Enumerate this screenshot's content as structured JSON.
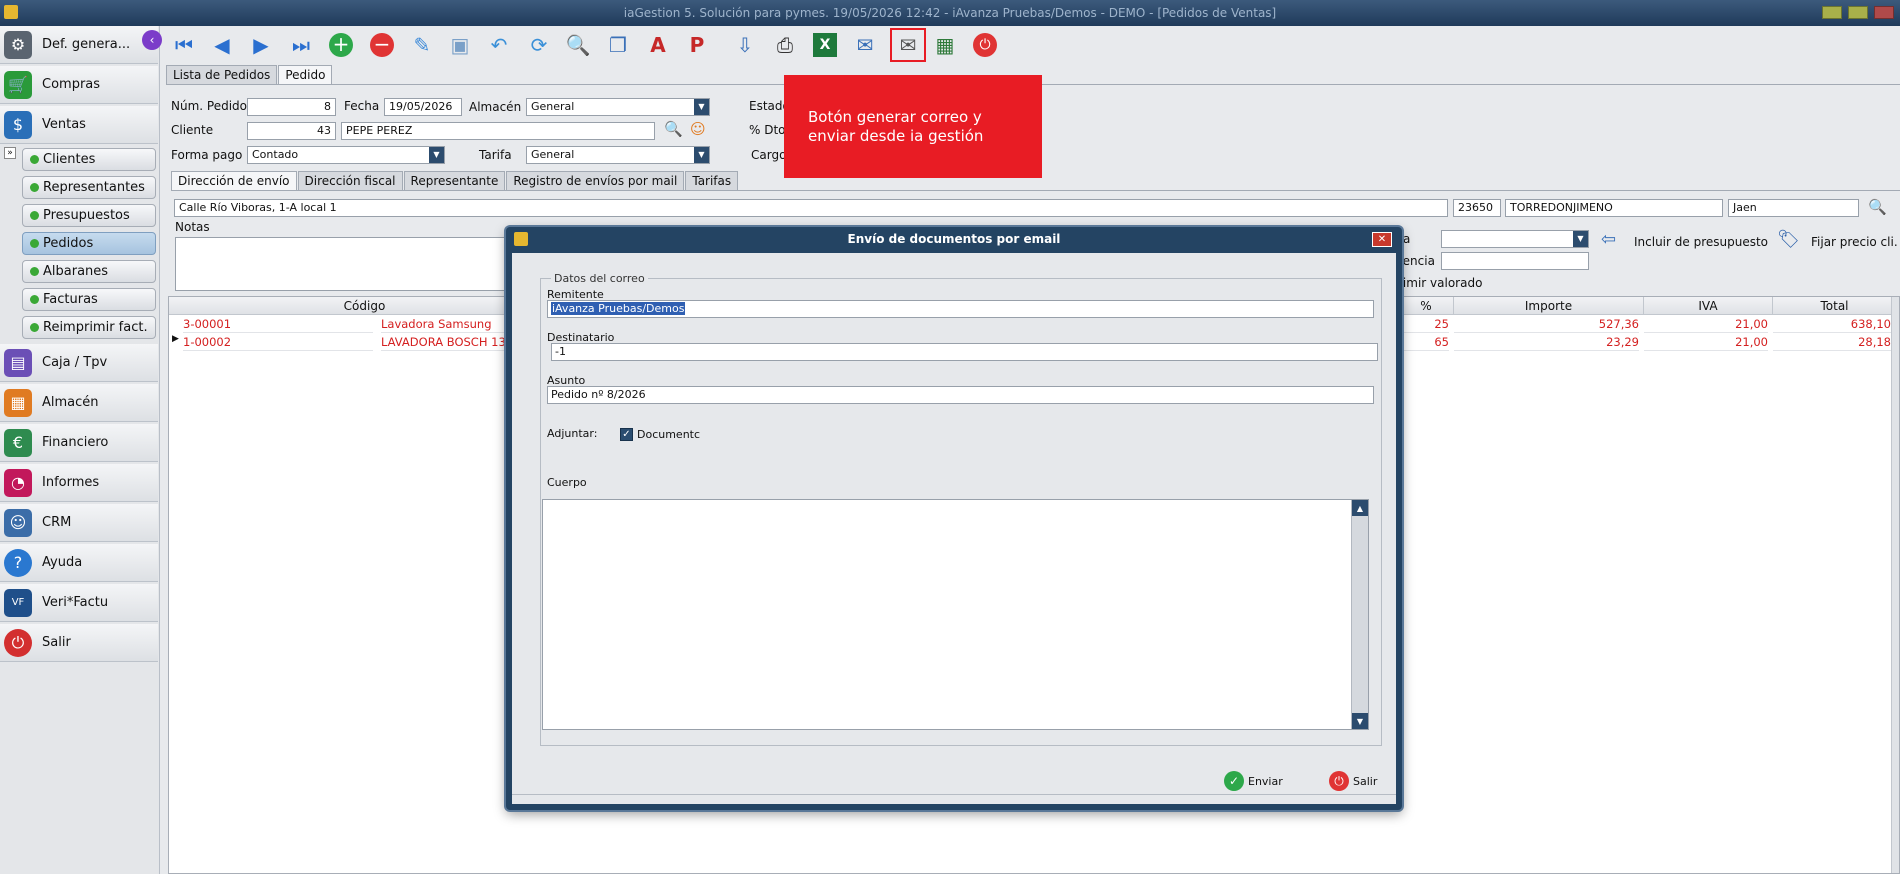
{
  "window": {
    "title": "iaGestion 5. Solución para pymes.  19/05/2026 12:42  -  iAvanza Pruebas/Demos - DEMO - [Pedidos de Ventas]"
  },
  "sidebar": {
    "items": [
      {
        "label": "Def. genera...",
        "icon": "gear-icon",
        "color": "#5a6470"
      },
      {
        "label": "Compras",
        "icon": "cart-icon",
        "color": "#2a9a3a"
      },
      {
        "label": "Ventas",
        "icon": "sales-icon",
        "color": "#2a6fb8"
      },
      {
        "label": "Caja / Tpv",
        "icon": "cash-register-icon",
        "color": "#6b4fb6"
      },
      {
        "label": "Almacén",
        "icon": "warehouse-icon",
        "color": "#e07b22"
      },
      {
        "label": "Financiero",
        "icon": "finance-icon",
        "color": "#2e8b4f"
      },
      {
        "label": "Informes",
        "icon": "reports-icon",
        "color": "#c2185b"
      },
      {
        "label": "CRM",
        "icon": "crm-icon",
        "color": "#3b6da8"
      },
      {
        "label": "Ayuda",
        "icon": "help-icon",
        "color": "#2a78d0"
      },
      {
        "label": "Veri*Factu",
        "icon": "verifactu-icon",
        "color": "#1f4f8a"
      },
      {
        "label": "Salir",
        "icon": "power-icon",
        "color": "#d32f2f"
      }
    ],
    "subitems": [
      {
        "label": "Clientes",
        "active": false
      },
      {
        "label": "Representantes",
        "active": false
      },
      {
        "label": "Presupuestos",
        "active": false
      },
      {
        "label": "Pedidos",
        "active": true
      },
      {
        "label": "Albaranes",
        "active": false
      },
      {
        "label": "Facturas",
        "active": false
      },
      {
        "label": "Reimprimir fact.",
        "active": false
      }
    ]
  },
  "toolbar": {
    "buttons": [
      "first-icon",
      "prev-icon",
      "next-icon",
      "last-icon",
      "add-icon",
      "delete-icon",
      "edit-icon",
      "save-icon",
      "undo-icon",
      "refresh-icon",
      "search-doc-icon",
      "copy-doc-icon",
      "pdf-icon",
      "pdf-export-icon",
      "import-icon",
      "print-icon",
      "excel-icon",
      "email-icon",
      "email-generate-icon",
      "calculator-icon",
      "power-icon"
    ]
  },
  "tabs_main": [
    "Lista de Pedidos",
    "Pedido"
  ],
  "form": {
    "num_pedido_label": "Núm. Pedido",
    "num_pedido": "8",
    "fecha_label": "Fecha",
    "fecha": "19/05/2026",
    "almacen_label": "Almacén",
    "almacen": "General",
    "estado_label": "Estado",
    "cliente_label": "Cliente",
    "cliente_code": "43",
    "cliente_name": "PEPE PEREZ",
    "dto_label": "% Dto",
    "forma_pago_label": "Forma pago",
    "forma_pago": "Contado",
    "tarifa_label": "Tarifa",
    "tarifa": "General",
    "cargo_label": "Cargo",
    "notas_label": "Notas"
  },
  "tabs_sub": [
    "Dirección de envío",
    "Dirección fiscal",
    "Representante",
    "Registro de envíos por mail",
    "Tarifas"
  ],
  "address": {
    "street": "Calle Río Viboras, 1-A local 1",
    "zip": "23650",
    "city": "TORREDONJIMENO",
    "province": "Jaen"
  },
  "right_panel": {
    "incluir_label": "Incluir de presupuesto",
    "fijar_label": "Fijar precio cli.",
    "partial_a": "a",
    "partial_rencia": "rencia",
    "partial_valorado": "rimir valorado"
  },
  "grid": {
    "columns": [
      "Código",
      "%",
      "Importe",
      "IVA",
      "Total"
    ],
    "rows": [
      {
        "codigo": "3-00001",
        "descripcion": "Lavadora Samsung",
        "pct": "25",
        "importe": "527,36",
        "iva": "21,00",
        "total": "638,10"
      },
      {
        "codigo": "1-00002",
        "descripcion": "LAVADORA BOSCH 13",
        "pct": "65",
        "importe": "23,29",
        "iva": "21,00",
        "total": "28,18"
      }
    ]
  },
  "callout": {
    "text": "Botón generar correo y enviar desde ia gestión"
  },
  "dialog": {
    "title": "Envío de documentos por email",
    "group_label": "Datos del correo",
    "remitente_label": "Remitente",
    "remitente": "iAvanza Pruebas/Demos",
    "destinatario_label": "Destinatario",
    "destinatario": "-1",
    "asunto_label": "Asunto",
    "asunto": "Pedido nº 8/2026",
    "adjuntar_label": "Adjuntar:",
    "documento_label": "Documentc",
    "cuerpo_label": "Cuerpo",
    "enviar_label": "Enviar",
    "salir_label": "Salir"
  }
}
